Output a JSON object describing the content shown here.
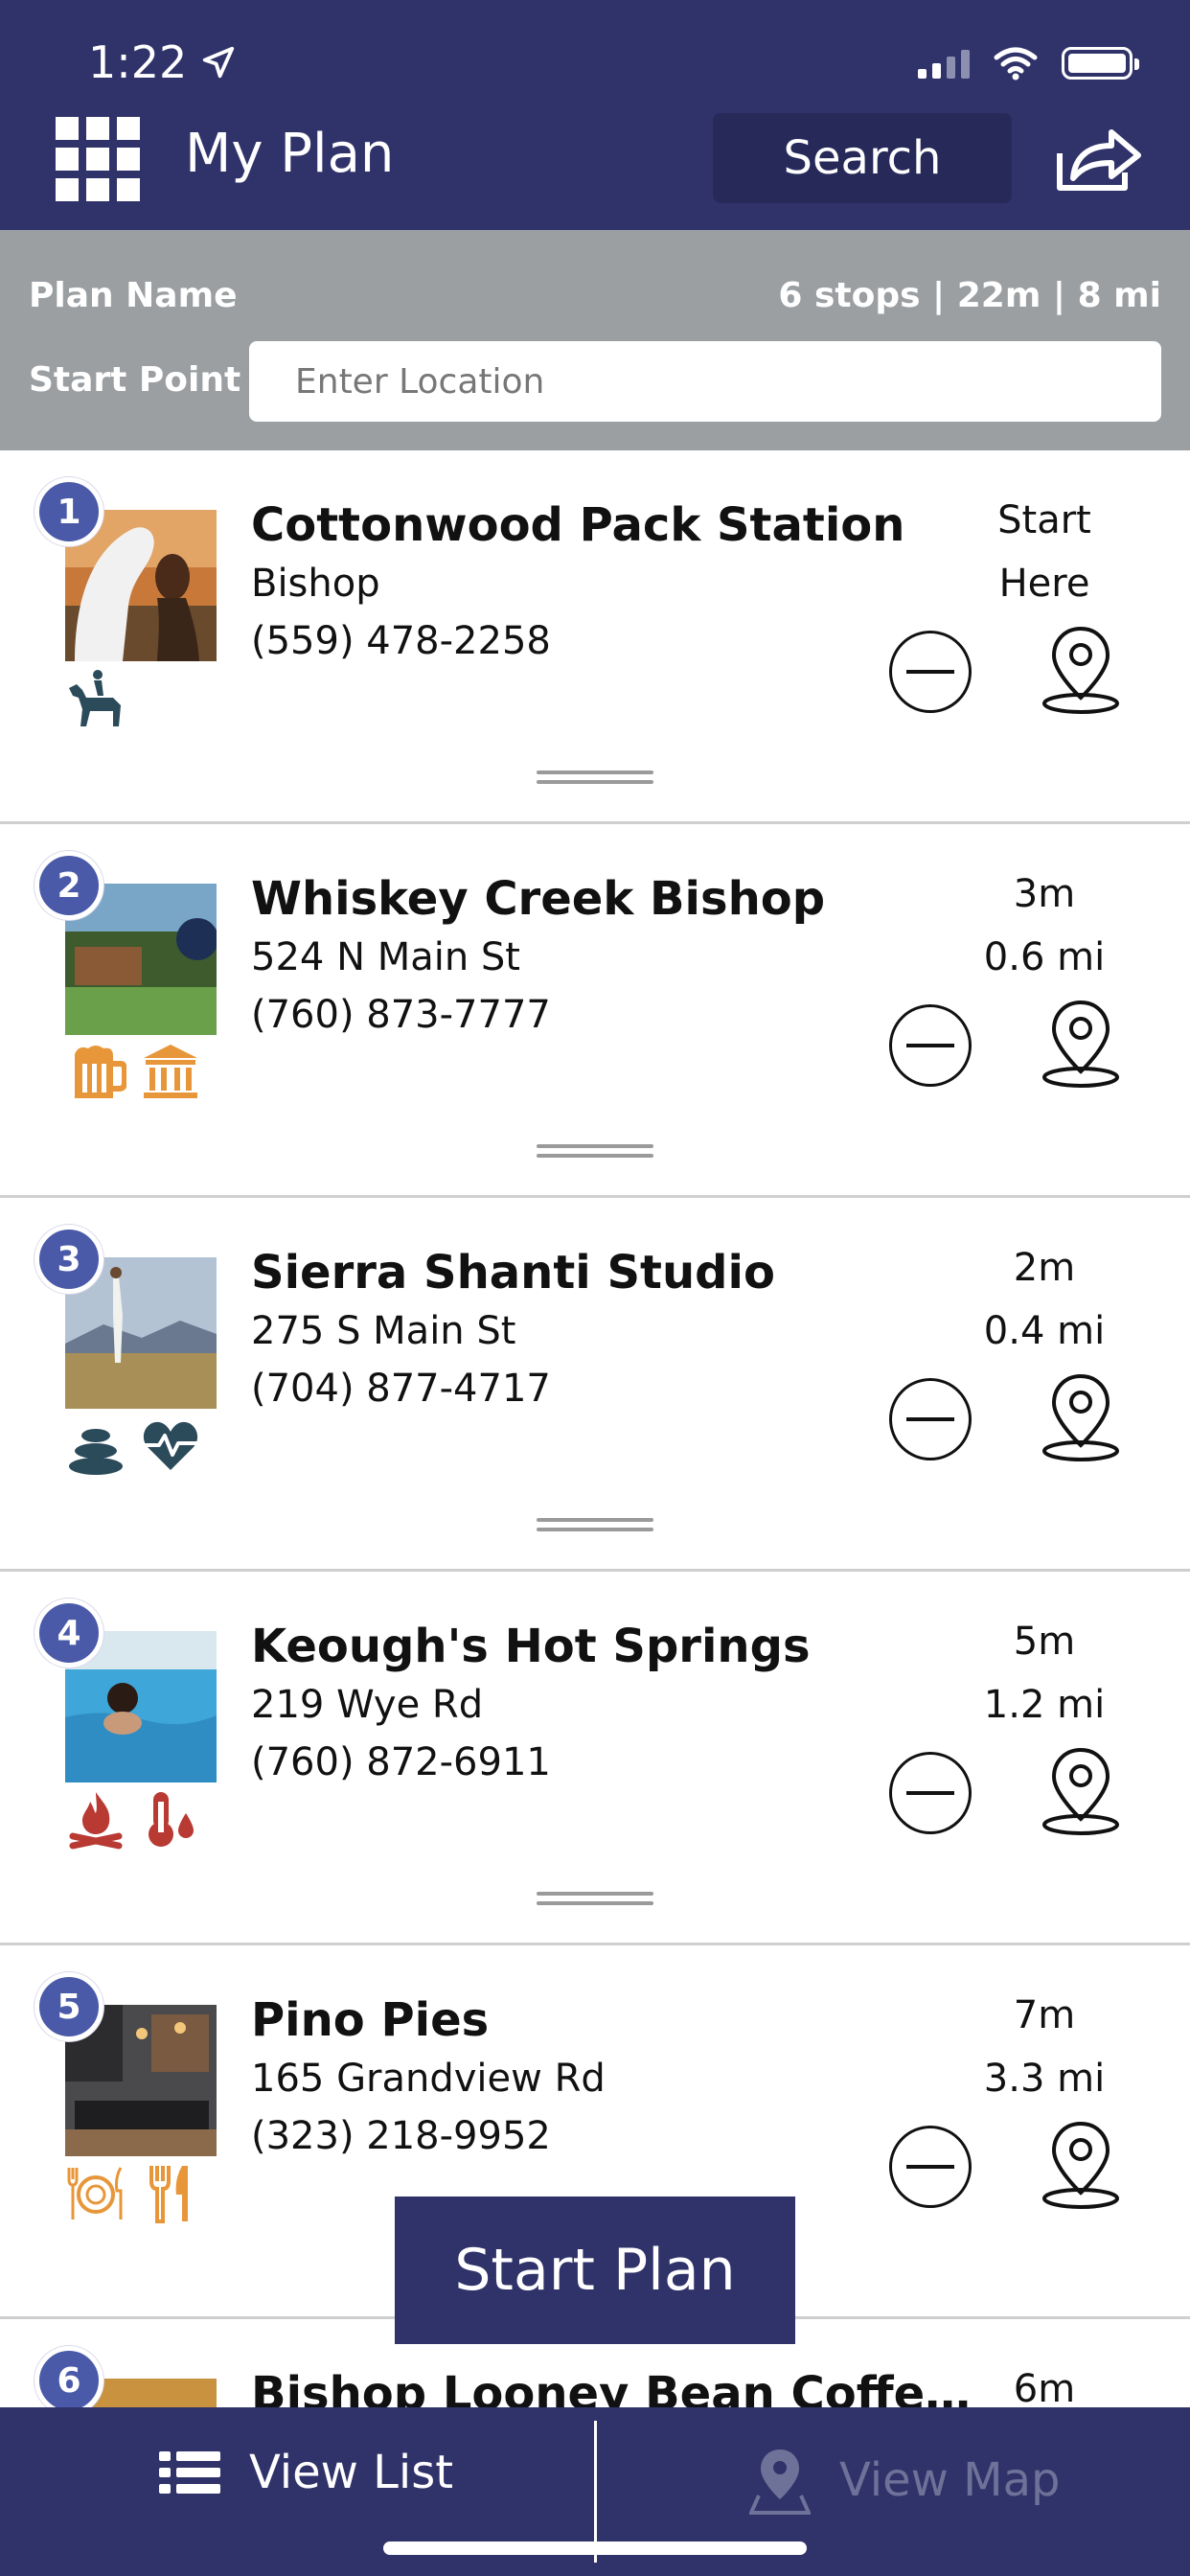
{
  "status_bar": {
    "time": "1:22"
  },
  "header": {
    "title": "My Plan",
    "search_label": "Search"
  },
  "plan": {
    "name_label": "Plan Name",
    "stats": "6 stops | 22m | 8 mi",
    "start_label": "Start Point",
    "start_placeholder": "Enter Location"
  },
  "stops": [
    {
      "number": "1",
      "name": "Cottonwood Pack Station",
      "line1": "Bishop",
      "phone": "(559) 478-2258",
      "dist_line1": "Start",
      "dist_line2": "Here"
    },
    {
      "number": "2",
      "name": "Whiskey Creek Bishop",
      "line1": "524 N Main St",
      "phone": "(760) 873-7777",
      "dist_line1": "3m",
      "dist_line2": "0.6 mi"
    },
    {
      "number": "3",
      "name": "Sierra Shanti Studio",
      "line1": "275 S Main St",
      "phone": "(704) 877-4717",
      "dist_line1": "2m",
      "dist_line2": "0.4 mi"
    },
    {
      "number": "4",
      "name": "Keough's Hot Springs",
      "line1": "219 Wye Rd",
      "phone": "(760) 872-6911",
      "dist_line1": "5m",
      "dist_line2": "1.2 mi"
    },
    {
      "number": "5",
      "name": "Pino Pies",
      "line1": "165 Grandview Rd",
      "phone": "(323) 218-9952",
      "dist_line1": "7m",
      "dist_line2": "3.3 mi"
    },
    {
      "number": "6",
      "name": "Bishop Looney Bean Coffee &...",
      "line1": "",
      "phone": "",
      "dist_line1": "6m",
      "dist_line2": ""
    }
  ],
  "actions": {
    "start_plan": "Start Plan"
  },
  "bottom_nav": {
    "view_list": "View List",
    "view_map": "View Map"
  },
  "colors": {
    "navy": "#30336a",
    "badge": "#4a5aa8",
    "plan_bar": "#9b9fa2",
    "icon_dark": "#2b4a5a",
    "icon_orange": "#e8963a",
    "icon_red": "#b83a32"
  },
  "icons": {
    "stop_1": [
      "horse-rider-icon"
    ],
    "stop_2": [
      "beer-mug-icon",
      "museum-icon"
    ],
    "stop_3": [
      "spa-stones-icon",
      "heart-pulse-icon"
    ],
    "stop_4": [
      "campfire-icon",
      "thermometer-icon"
    ],
    "stop_5": [
      "dining-plate-icon",
      "fork-knife-icon"
    ]
  }
}
